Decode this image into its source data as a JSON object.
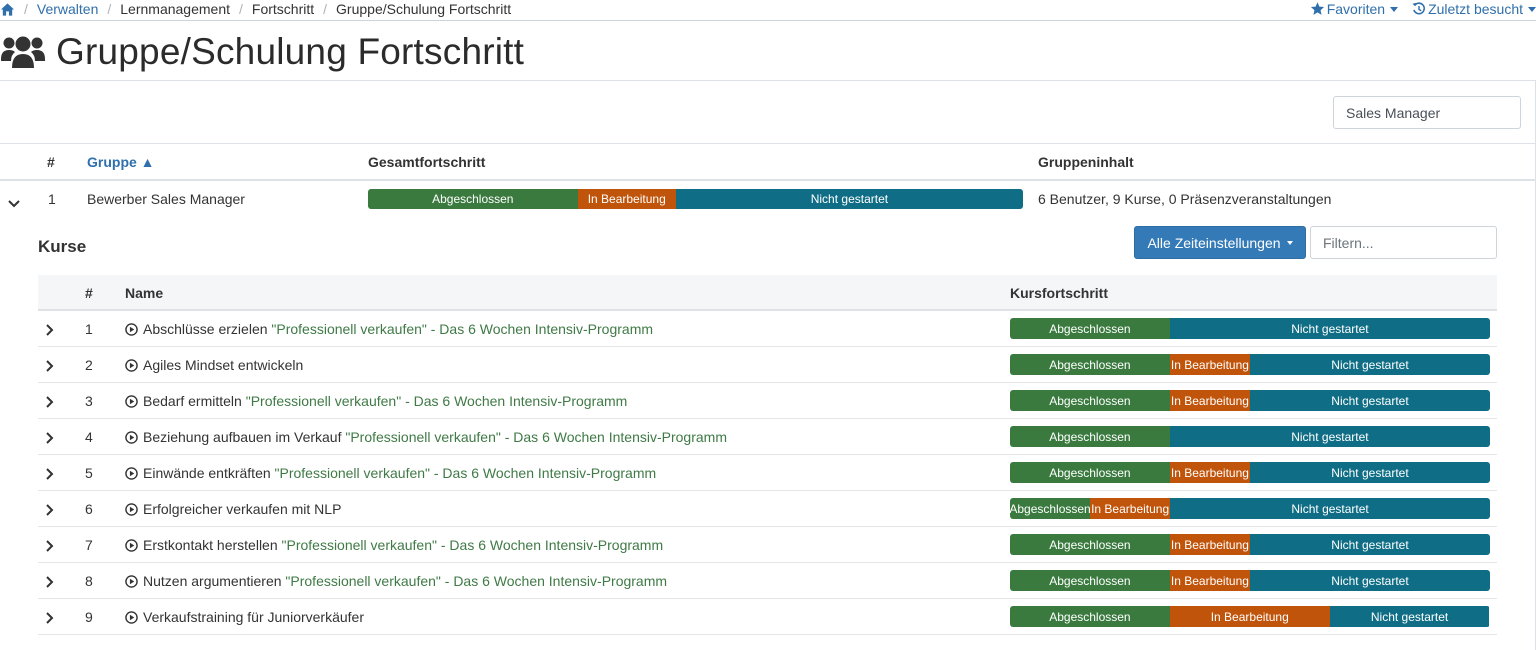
{
  "breadcrumb": {
    "items": [
      "Verwalten",
      "Lernmanagement",
      "Fortschritt",
      "Gruppe/Schulung Fortschritt"
    ]
  },
  "topright": {
    "favorites": "Favoriten",
    "recent": "Zuletzt besucht"
  },
  "page": {
    "title": "Gruppe/Schulung Fortschritt"
  },
  "group_search": {
    "value": "Sales Manager"
  },
  "group_table": {
    "columns": [
      "#",
      "Gruppe",
      "Gesamtfortschritt",
      "Gruppeninhalt"
    ],
    "sort_indicator": "▲",
    "rows": [
      {
        "num": "1",
        "name": "Bewerber Sales Manager",
        "progress": {
          "done": 0.32,
          "prog": 0.15,
          "not": 0.53
        },
        "content": "6 Benutzer, 9 Kurse, 0 Präsenzveranstaltungen"
      }
    ]
  },
  "progress_labels": {
    "done": "Abgeschlossen",
    "prog": "In Bearbeitung",
    "not": "Nicht gestartet"
  },
  "colors": {
    "done": "#3a7a3f",
    "prog": "#c0540a",
    "not": "#0f6e85",
    "link": "#2f6fab",
    "button": "#337ab7",
    "course_subtitle": "#3f7a46"
  },
  "courses": {
    "title": "Kurse",
    "time_button": "Alle Zeiteinstellungen",
    "filter_placeholder": "Filtern...",
    "columns": [
      "#",
      "Name",
      "Kursfortschritt"
    ],
    "rows": [
      {
        "num": "1",
        "name": "Abschlüsse erzielen",
        "subtitle": "\"Professionell verkaufen\" - Das 6 Wochen Intensiv-Programm",
        "progress": {
          "done": 0.333,
          "prog": 0,
          "not": 0.667
        }
      },
      {
        "num": "2",
        "name": "Agiles Mindset entwickeln",
        "subtitle": "",
        "progress": {
          "done": 0.333,
          "prog": 0.167,
          "not": 0.5
        }
      },
      {
        "num": "3",
        "name": "Bedarf ermitteln",
        "subtitle": "\"Professionell verkaufen\" - Das 6 Wochen Intensiv-Programm",
        "progress": {
          "done": 0.333,
          "prog": 0.167,
          "not": 0.5
        }
      },
      {
        "num": "4",
        "name": "Beziehung aufbauen im Verkauf",
        "subtitle": "\"Professionell verkaufen\" - Das 6 Wochen Intensiv-Programm",
        "progress": {
          "done": 0.333,
          "prog": 0,
          "not": 0.667
        }
      },
      {
        "num": "5",
        "name": "Einwände entkräften",
        "subtitle": "\"Professionell verkaufen\" - Das 6 Wochen Intensiv-Programm",
        "progress": {
          "done": 0.333,
          "prog": 0.167,
          "not": 0.5
        }
      },
      {
        "num": "6",
        "name": "Erfolgreicher verkaufen mit NLP",
        "subtitle": "",
        "progress": {
          "done": 0.167,
          "prog": 0.167,
          "not": 0.667
        }
      },
      {
        "num": "7",
        "name": "Erstkontakt herstellen",
        "subtitle": "\"Professionell verkaufen\" - Das 6 Wochen Intensiv-Programm",
        "progress": {
          "done": 0.333,
          "prog": 0.167,
          "not": 0.5
        }
      },
      {
        "num": "8",
        "name": "Nutzen argumentieren",
        "subtitle": "\"Professionell verkaufen\" - Das 6 Wochen Intensiv-Programm",
        "progress": {
          "done": 0.333,
          "prog": 0.167,
          "not": 0.5
        }
      },
      {
        "num": "9",
        "name": "Verkaufstraining für Juniorverkäufer",
        "subtitle": "",
        "progress": {
          "done": 0.333,
          "prog": 0.333,
          "not": 0.333
        }
      }
    ]
  }
}
